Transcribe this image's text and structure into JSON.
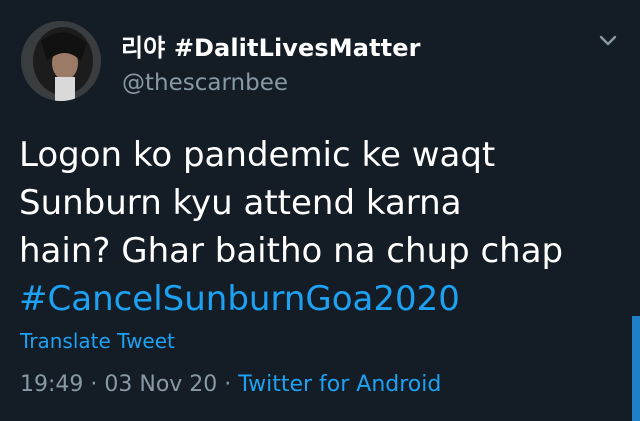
{
  "tweet": {
    "display_name": "리야 #DalitLivesMatter",
    "handle": "@thescarnbee",
    "text_lines": [
      "Logon ko pandemic ke waqt",
      "Sunburn kyu attend karna",
      "hain? Ghar baitho na chup chap"
    ],
    "hashtag": "#CancelSunburnGoa2020",
    "translate_label": "Translate Tweet",
    "time": "19:49",
    "separator": " · ",
    "date": "03 Nov 20",
    "source": "Twitter for Android"
  },
  "icons": {
    "avatar": "profile-photo",
    "caret": "chevron-down-icon"
  },
  "colors": {
    "background": "#141d26",
    "text": "#ffffff",
    "secondary": "#8899a6",
    "link": "#1da1f2"
  }
}
